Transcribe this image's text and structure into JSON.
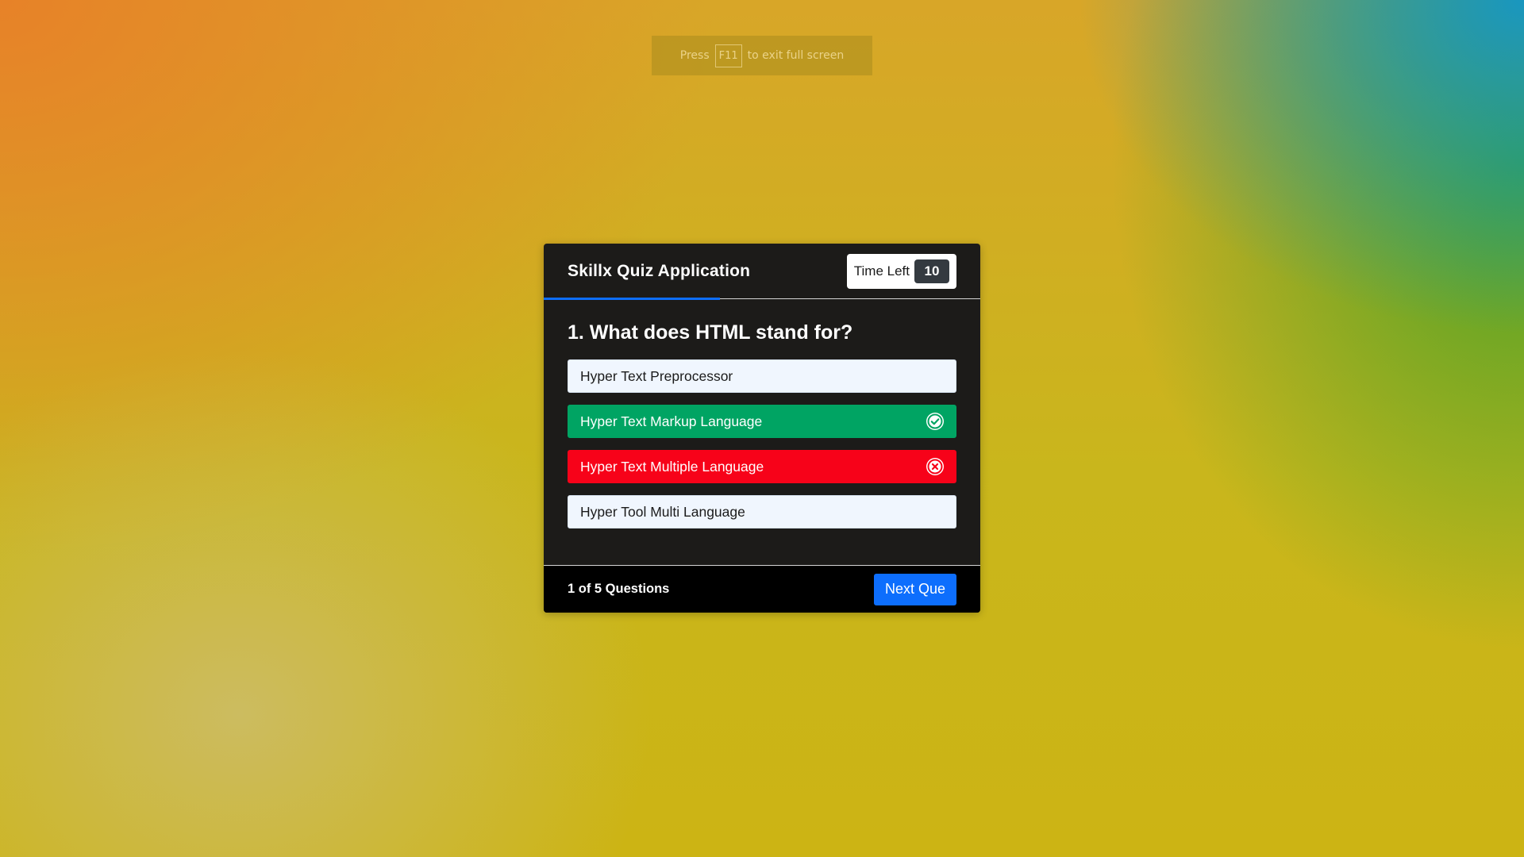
{
  "fullscreen_notice": {
    "prefix": "Press",
    "key": "F11",
    "suffix": "to exit full screen"
  },
  "quiz": {
    "title": "Skillx Quiz Application",
    "timer": {
      "label": "Time Left",
      "value": "10"
    },
    "question": {
      "text": "1. What does HTML stand for?",
      "options": [
        {
          "label": "Hyper Text Preprocessor",
          "state": "default"
        },
        {
          "label": "Hyper Text Markup Language",
          "state": "correct",
          "icon": "check-circle-icon"
        },
        {
          "label": "Hyper Text Multiple Language",
          "state": "incorrect",
          "icon": "x-circle-icon"
        },
        {
          "label": "Hyper Tool Multi Language",
          "state": "default"
        }
      ]
    },
    "footer": {
      "counter": "1 of 5 Questions",
      "next_label": "Next Que"
    }
  },
  "colors": {
    "accent": "#0d6efd",
    "correct": "#00a463",
    "incorrect": "#f70219",
    "card": "#1c1b19"
  }
}
